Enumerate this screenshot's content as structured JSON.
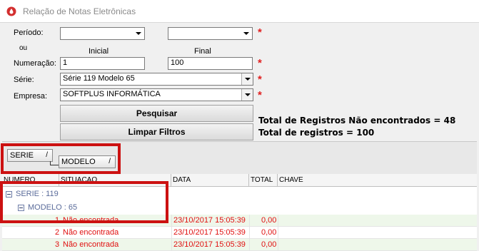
{
  "window": {
    "title": "Relação de Notas Eletrônicas"
  },
  "filters": {
    "periodo_label": "Período:",
    "ou_label": "ou",
    "inicial_label": "Inicial",
    "final_label": "Final",
    "numeracao_label": "Numeração:",
    "numeracao_inicial": "1",
    "numeracao_final": "100",
    "serie_label": "Série:",
    "serie_value": "Série 119 Modelo 65",
    "empresa_label": "Empresa:",
    "empresa_value": "SOFTPLUS INFORMÁTICA",
    "required_mark": "*"
  },
  "buttons": {
    "pesquisar": "Pesquisar",
    "limpar": "Limpar Filtros"
  },
  "stats": {
    "nao_encontrados": "Total de Registros Não encontrados = 48",
    "total": "Total de registros = 100"
  },
  "grouping": {
    "serie_tag": "SERIE",
    "modelo_tag": "MODELO",
    "sort_glyph": "/"
  },
  "grid": {
    "columns": [
      "NUMERO",
      "SITUACAO",
      "DATA",
      "TOTAL",
      "CHAVE"
    ],
    "group_serie": "SERIE : 119",
    "group_modelo": "MODELO : 65",
    "rows": [
      {
        "numero": "1",
        "situacao": "Não encontrada",
        "data": "23/10/2017 15:05:39",
        "total": "0,00",
        "chave": ""
      },
      {
        "numero": "2",
        "situacao": "Não encontrada",
        "data": "23/10/2017 15:05:39",
        "total": "0,00",
        "chave": ""
      },
      {
        "numero": "3",
        "situacao": "Não encontrada",
        "data": "23/10/2017 15:05:39",
        "total": "0,00",
        "chave": ""
      }
    ]
  },
  "colors": {
    "required": "#e02020",
    "row_text": "#e01010",
    "group_text": "#5a6b9a",
    "highlight": "#cc1111",
    "row_bg": "#eef7ea"
  }
}
